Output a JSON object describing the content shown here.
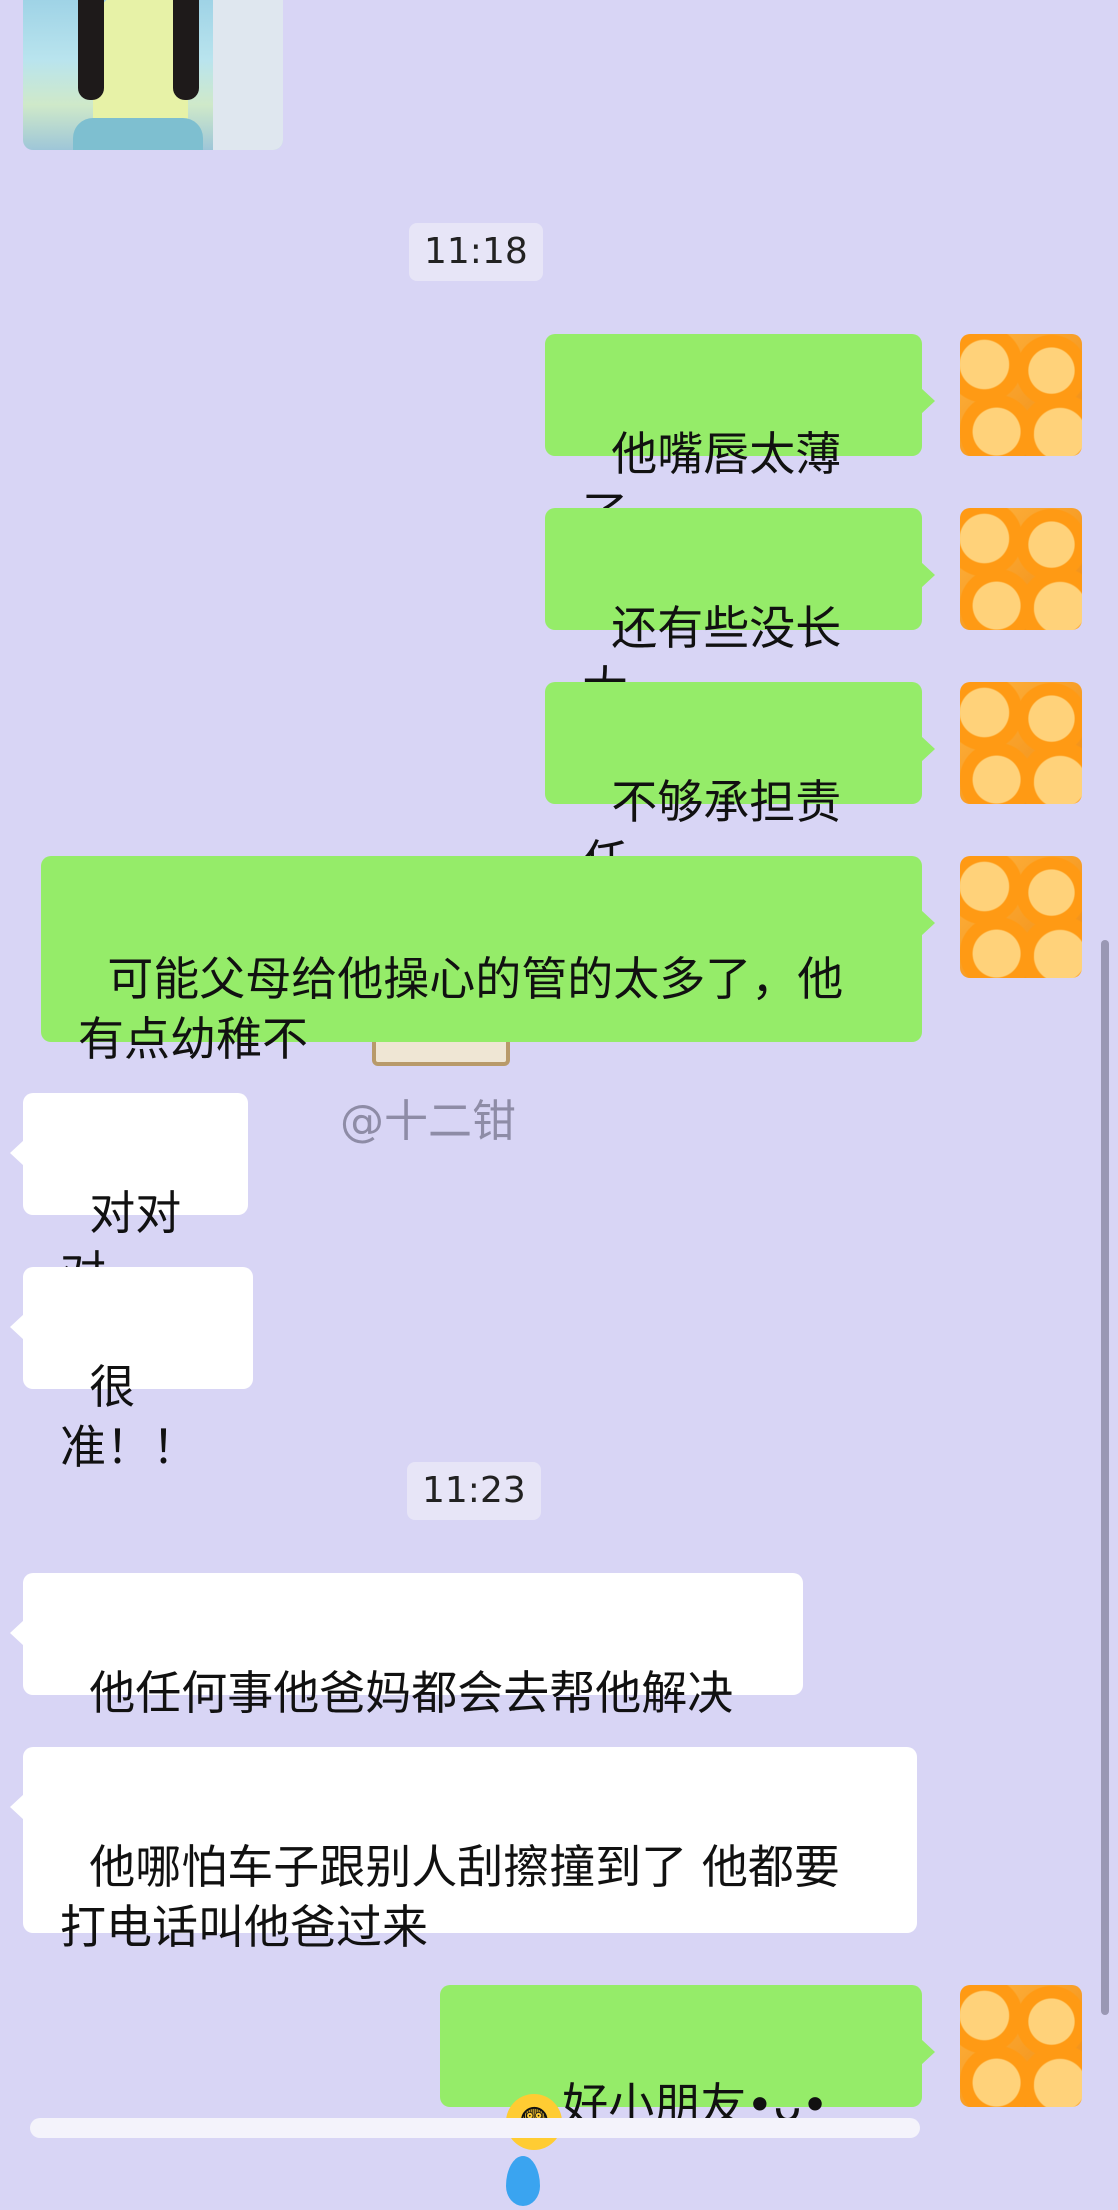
{
  "timestamps": [
    "11:18",
    "11:23"
  ],
  "messages": {
    "m1": "他嘴唇太薄了",
    "m2": "还有些没长大",
    "m3": "不够承担责任",
    "m4": "可能父母给他操心的管的太多了，他有点幼稚不",
    "m5": "对对对",
    "m6": "很准！！",
    "m7": "他任何事他爸妈都会去帮他解决",
    "m8": "他哪怕车子跟别人刮擦撞到了 他都要打电话叫他爸过来",
    "m9": "好小朋友•ᴗ•"
  },
  "watermark": "@十二钳",
  "icons": {
    "emoji_1": "fearful-face-emoji",
    "emoji_2": "droplet-emoji",
    "avatar": "orange-slices-avatar"
  },
  "colors": {
    "background": "#d8d5f5",
    "outgoing_bubble": "#95ec69",
    "incoming_bubble": "#ffffff"
  }
}
